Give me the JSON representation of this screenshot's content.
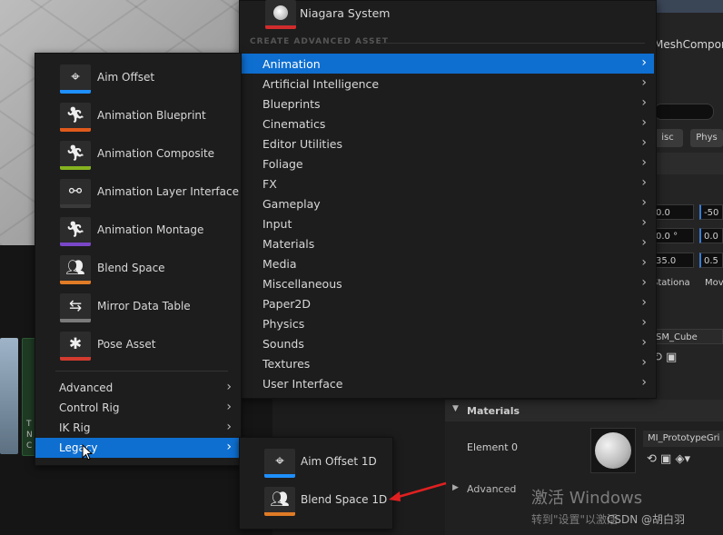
{
  "niagara": {
    "label": "Niagara System"
  },
  "section": {
    "header": "CREATE ADVANCED ASSET"
  },
  "categories": [
    {
      "label": "Animation",
      "selected": true
    },
    {
      "label": "Artificial Intelligence"
    },
    {
      "label": "Blueprints"
    },
    {
      "label": "Cinematics"
    },
    {
      "label": "Editor Utilities"
    },
    {
      "label": "Foliage"
    },
    {
      "label": "FX"
    },
    {
      "label": "Gameplay"
    },
    {
      "label": "Input"
    },
    {
      "label": "Materials"
    },
    {
      "label": "Media"
    },
    {
      "label": "Miscellaneous"
    },
    {
      "label": "Paper2D"
    },
    {
      "label": "Physics"
    },
    {
      "label": "Sounds"
    },
    {
      "label": "Textures"
    },
    {
      "label": "User Interface"
    }
  ],
  "animation_assets": [
    {
      "label": "Aim Offset",
      "icon": "crosshair-icon",
      "bar": "#1e90ff"
    },
    {
      "label": "Animation Blueprint",
      "icon": "running-figure-icon",
      "bar": "#e05a1c"
    },
    {
      "label": "Animation Composite",
      "icon": "running-figure-icon",
      "bar": "#86b31f"
    },
    {
      "label": "Animation Layer Interface",
      "icon": "node-graph-icon",
      "bar": "#3a3a3a"
    },
    {
      "label": "Animation Montage",
      "icon": "running-figure-icon",
      "bar": "#7a46c8"
    },
    {
      "label": "Blend Space",
      "icon": "figures-icon",
      "bar": "#e07b26"
    },
    {
      "label": "Mirror Data Table",
      "icon": "mirror-figures-icon",
      "bar": "#7a7a7a"
    },
    {
      "label": "Pose Asset",
      "icon": "pose-figure-icon",
      "bar": "#d23b2e"
    }
  ],
  "animation_subcategories": [
    {
      "label": "Advanced"
    },
    {
      "label": "Control Rig"
    },
    {
      "label": "IK Rig"
    },
    {
      "label": "Legacy",
      "selected": true
    }
  ],
  "legacy_assets": [
    {
      "label": "Aim Offset 1D",
      "icon": "crosshair-icon",
      "bar": "#1e90ff"
    },
    {
      "label": "Blend Space 1D",
      "icon": "figures-icon",
      "bar": "#e07b26"
    }
  ],
  "details": {
    "title_fragment": "MeshCompor",
    "btn_misc": "isc",
    "btn_physics": "Phys",
    "row1": [
      "0.0",
      "-50"
    ],
    "row2": [
      "0.0 °",
      "0.0"
    ],
    "row3": [
      "35.0",
      "0.5"
    ],
    "mobility_left": "Stationa",
    "mobility_right": "Mov",
    "mesh_name": "SM_Cube"
  },
  "materials": {
    "header": "Materials",
    "element_label": "Element 0",
    "material_name": "MI_PrototypeGri",
    "advanced_label": "Advanced"
  },
  "thumbnail_letters": [
    "T",
    "N",
    "C"
  ],
  "watermark": {
    "title": "激活 Windows",
    "subtitle": "转到\"设置\"以激活"
  },
  "csdn_tag": "CSDN @胡白羽",
  "colors": {
    "selected": "#0e6fd1",
    "menu_bg": "#1d1d1d",
    "arrow": "#e02020"
  }
}
